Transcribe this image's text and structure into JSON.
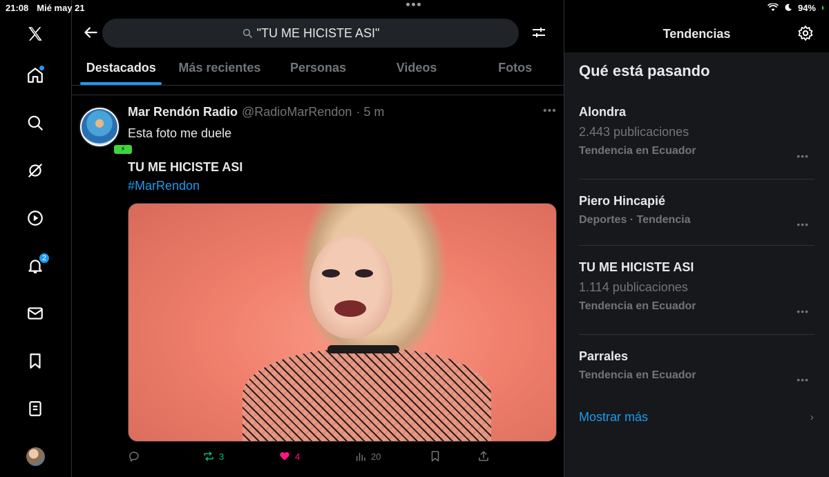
{
  "status": {
    "time": "21:08",
    "date": "Mié may 21",
    "battery": "94%"
  },
  "search": {
    "query": "\"TU ME HICISTE ASI\""
  },
  "tabs": [
    {
      "label": "Destacados",
      "active": true
    },
    {
      "label": "Más recientes",
      "active": false
    },
    {
      "label": "Personas",
      "active": false
    },
    {
      "label": "Videos",
      "active": false
    },
    {
      "label": "Fotos",
      "active": false
    }
  ],
  "nav": {
    "notifications_badge": "2"
  },
  "tweet": {
    "name": "Mar Rendón Radio",
    "handle": "@RadioMarRendon",
    "time": "· 5 m",
    "text": "Esta foto me duele",
    "bold_text": "TU ME HICISTE ASI",
    "hashtag": "#MarRendon",
    "retweets": "3",
    "likes": "4",
    "views": "20"
  },
  "right": {
    "header": "Tendencias",
    "section_title": "Qué está pasando",
    "trends": [
      {
        "name": "Alondra",
        "count": "2.443 publicaciones",
        "context": "Tendencia en Ecuador"
      },
      {
        "name": "Piero Hincapié",
        "count": "",
        "context": "Deportes · Tendencia"
      },
      {
        "name": "TU ME HICISTE ASI",
        "count": "1.114 publicaciones",
        "context": "Tendencia en Ecuador"
      },
      {
        "name": "Parrales",
        "count": "",
        "context": "Tendencia en Ecuador"
      }
    ],
    "show_more": "Mostrar más"
  },
  "colors": {
    "accent": "#1d9bf0",
    "like": "#f91880",
    "retweet": "#00ba7c",
    "background": "#000000"
  }
}
